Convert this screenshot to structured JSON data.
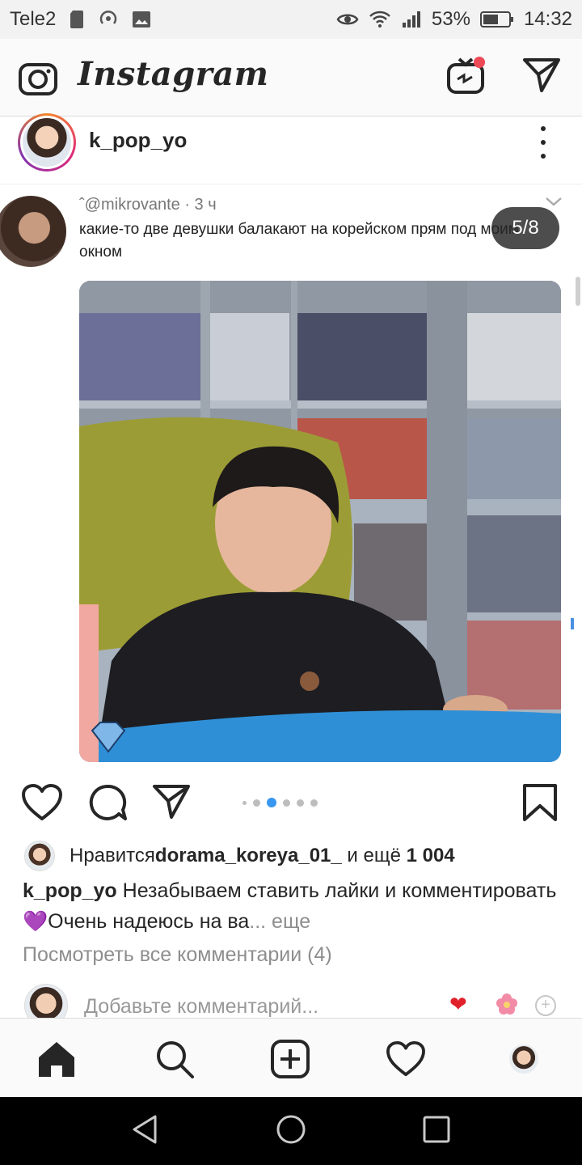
{
  "status_bar": {
    "carrier": "Tele2",
    "battery": "53%",
    "time": "14:32"
  },
  "header": {
    "logo": "Instagram",
    "icons": [
      "camera-icon",
      "igtv-icon",
      "direct-icon"
    ],
    "notification_dot_color": "#ed4956"
  },
  "post": {
    "username": "k_pop_yo",
    "tweet": {
      "meta": "ˆ@mikrovante · 3 ч",
      "text": "какие-то две девушки балакают на корейском прям под моим окном"
    },
    "carousel_counter": "5/8",
    "likes": {
      "prefix": "Нравится ",
      "user": "dorama_koreya_01_",
      "middle": " и ещё ",
      "count": "1 004"
    },
    "caption": {
      "username": "k_pop_yo",
      "text": " Незабываем ставить лайки и комментировать💜Очень надеюсь на ва",
      "more": "... еще"
    },
    "view_comments": "Посмотреть все комментарии (4)",
    "add_comment_placeholder": "Добавьте комментарий..."
  },
  "colors": {
    "accent": "#3897f0",
    "like_red": "#ed4956",
    "text": "#262626",
    "muted": "#8e8e8e"
  }
}
